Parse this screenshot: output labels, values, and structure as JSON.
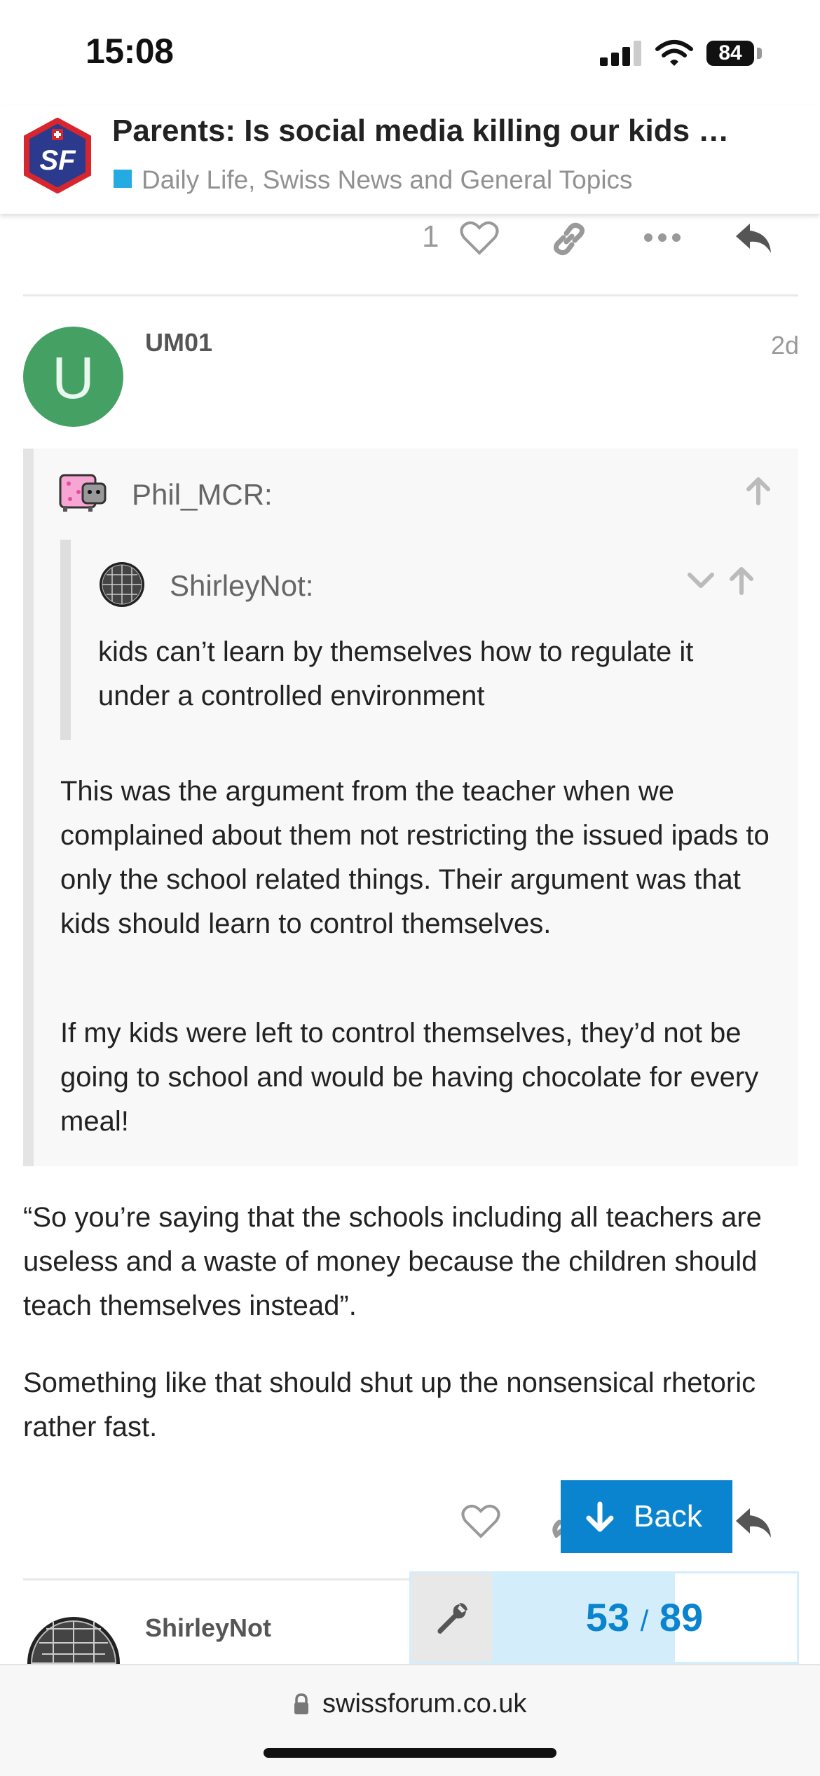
{
  "status_bar": {
    "time": "15:08",
    "battery": "84"
  },
  "header": {
    "topic_title": "Parents: Is social media killing our kids …",
    "category": "Daily Life, Swiss News and General Topics",
    "category_color": "#25aae1",
    "logo_text": "SF"
  },
  "prev_post_actions": {
    "like_count": "1"
  },
  "post": {
    "username": "UM01",
    "avatar_letter": "U",
    "avatar_color": "#45a163",
    "date": "2d",
    "quote": {
      "author": "Phil_MCR:",
      "nested_quote": {
        "author": "ShirleyNot:",
        "text": "kids can’t learn by themselves how to regulate it under a controlled environment"
      },
      "paragraphs": [
        "This was the argument from the teacher when we complained about them not restricting the issued ipads to only the school related things. Their argument was that kids should learn to control themselves.",
        "If my kids were left to control themselves, they’d not be going to school and would be having chocolate for every meal!"
      ]
    },
    "paragraphs": [
      "“So you’re saying that the schools including all teachers are useless and a waste of money because the children should teach themselves instead”.",
      "Something like that should shut up the nonsensical rhetoric rather fast."
    ]
  },
  "back_button": {
    "label": "Back"
  },
  "progress": {
    "current": "53",
    "separator": "/",
    "total": "89",
    "fraction": 0.6
  },
  "next_post": {
    "username": "ShirleyNot"
  },
  "browser": {
    "url": "swissforum.co.uk"
  },
  "accent_color": "#0a84cf"
}
